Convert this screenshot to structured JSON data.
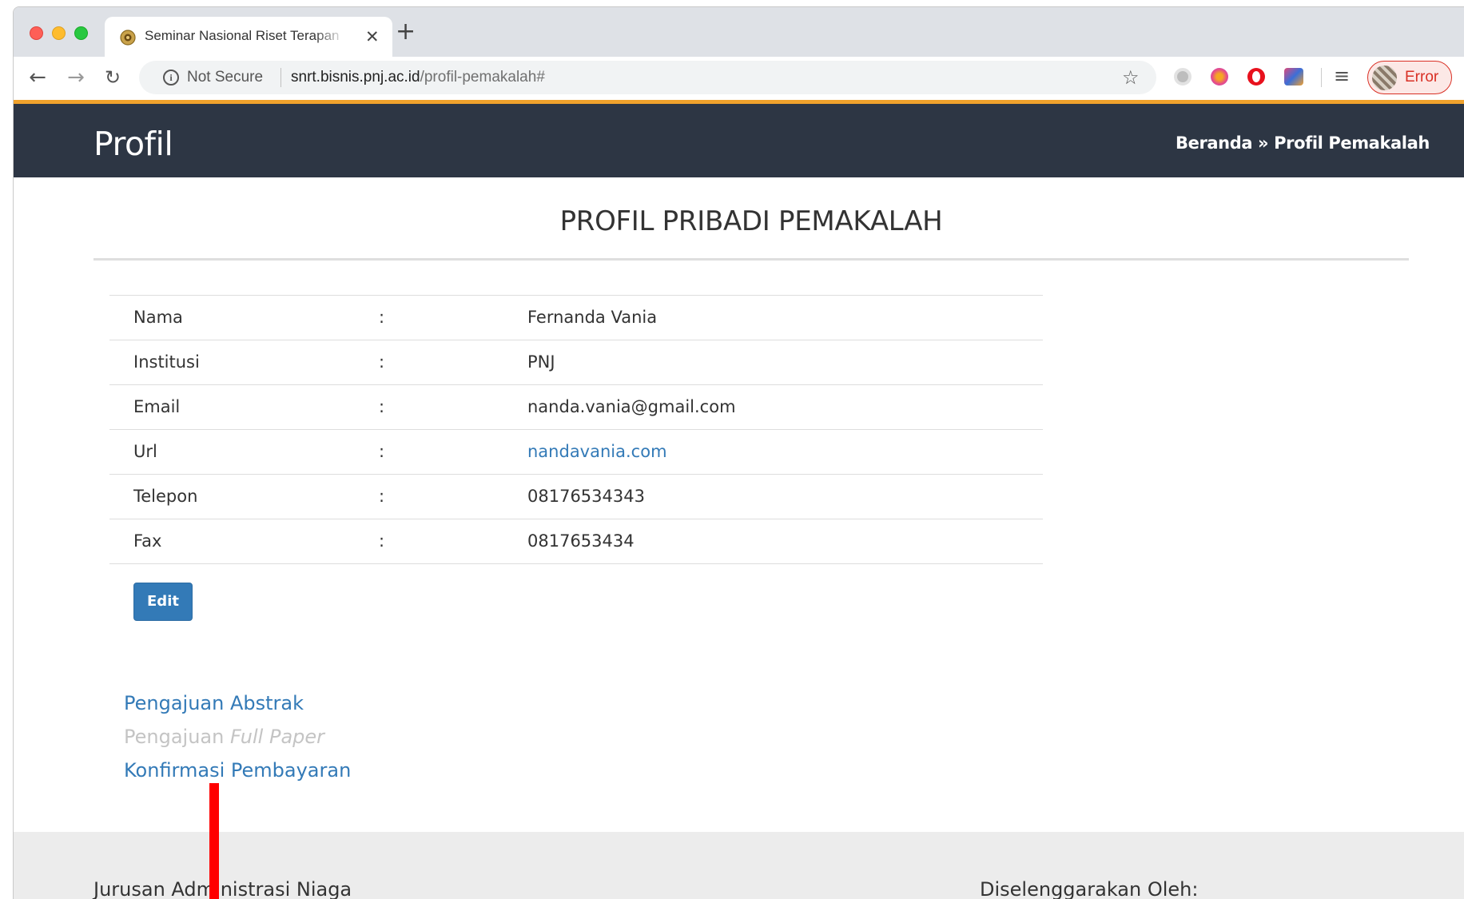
{
  "browser": {
    "tab_title": "Seminar Nasional Riset Terapan",
    "security_label": "Not Secure",
    "url_host": "snrt.bisnis.pnj.ac.id",
    "url_path": "/profil-pemakalah#",
    "profile_status": "Error"
  },
  "header": {
    "title": "Profil",
    "breadcrumb": {
      "home": "Beranda",
      "separator": " » ",
      "current": "Profil Pemakalah"
    }
  },
  "main": {
    "heading": "PROFIL PRIBADI PEMAKALAH",
    "separator": ":",
    "profile_rows": [
      {
        "label": "Nama",
        "value": "Fernanda Vania"
      },
      {
        "label": "Institusi",
        "value": "PNJ"
      },
      {
        "label": "Email",
        "value": "nanda.vania@gmail.com"
      },
      {
        "label": "Url",
        "value": "nandavania.com"
      },
      {
        "label": "Telepon",
        "value": "08176534343"
      },
      {
        "label": "Fax",
        "value": "0817653434"
      }
    ],
    "edit_label": "Edit",
    "links": {
      "abstract": "Pengajuan Abstrak",
      "full_paper_prefix": "Pengajuan ",
      "full_paper_italic": "Full Paper",
      "payment": "Konfirmasi Pembayaran"
    }
  },
  "footer": {
    "left_title": "Jurusan Administrasi Niaga",
    "right_title": "Diselenggarakan Oleh:"
  },
  "colors": {
    "header_bg": "#2d3644",
    "accent_bar": "#f0a22c",
    "link": "#337ab7",
    "button": "#337ab7",
    "error": "#d93025"
  },
  "icons": [
    "favicon-icon",
    "close-icon",
    "plus-icon",
    "back-arrow-icon",
    "forward-arrow-icon",
    "reload-icon",
    "info-icon",
    "star-icon",
    "media-control-icon",
    "more-vert-icon"
  ]
}
